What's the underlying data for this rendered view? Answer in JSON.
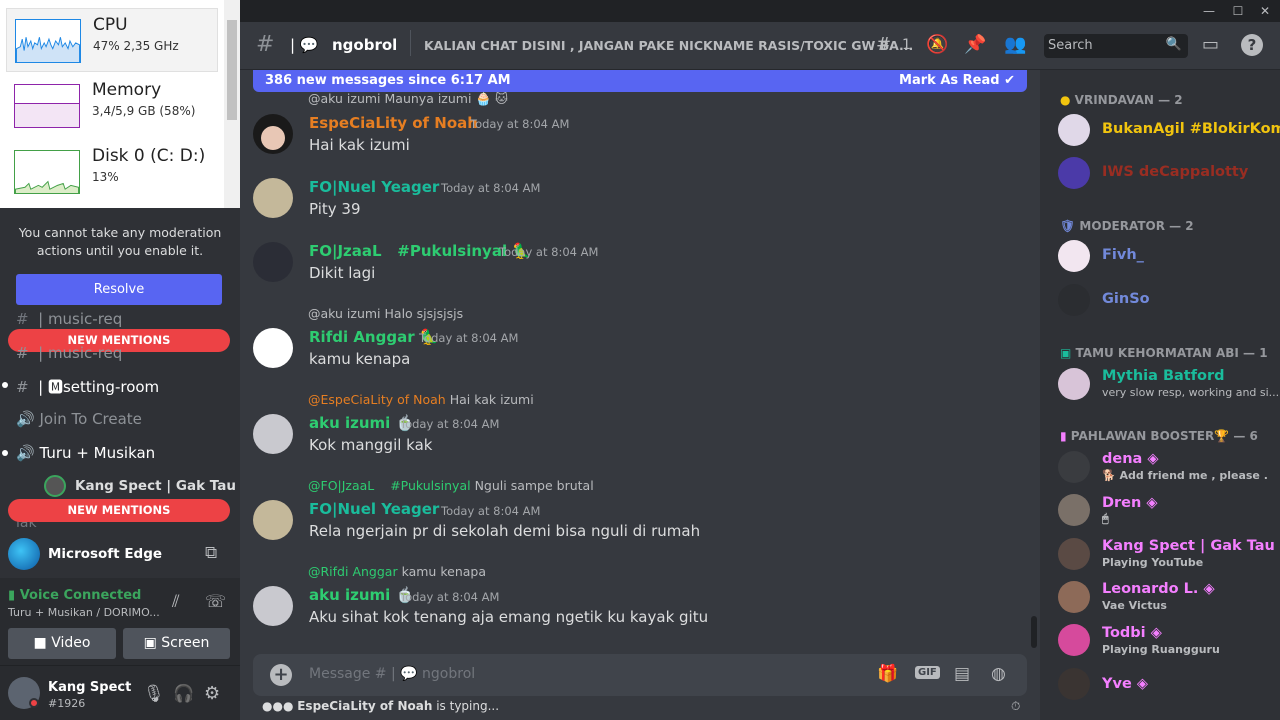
{
  "taskmgr": {
    "items": [
      {
        "name": "CPU",
        "value": "47% 2,35 GHz"
      },
      {
        "name": "Memory",
        "value": "3,4/5,9 GB (58%)"
      },
      {
        "name": "Disk 0 (C: D:)",
        "value": "13%"
      }
    ]
  },
  "moderation": {
    "message": "You cannot take any moderation actions until you enable it.",
    "resolve": "Resolve"
  },
  "sidebar": {
    "new_mentions": "NEW MENTIONS",
    "channels": [
      "music-req",
      "music-req",
      "| 🅼setting-room",
      "Join To Create",
      "Turu + Musikan",
      "Kang Spect | Gak Tau",
      "lak"
    ],
    "edge": "Microsoft Edge"
  },
  "voice": {
    "status": "Voice Connected",
    "channel": "Turu + Musikan / DORIMO...",
    "video": "Video",
    "screen": "Screen"
  },
  "user": {
    "name": "Kang Spect",
    "tag": "#1926"
  },
  "header": {
    "channel": "ngobrol",
    "prefix": "|",
    "topic": "KALIAN CHAT DISINI , JANGAN PAKE NICKNAME RASIS/TOXIC GW BA...",
    "threads": "1",
    "search": "Search"
  },
  "banner": {
    "text": "386 new messages since 6:17 AM",
    "mark": "Mark As Read"
  },
  "messages": [
    {
      "reply_user": "@aku izumi",
      "reply_text": "Maunya izumi",
      "user": "EspeCiaLity of Noah",
      "color": "#e67e22",
      "time": "Today at 8:04 AM",
      "text": "Hai kak izumi"
    },
    {
      "user": "FO|Nuel Yeager",
      "color": "#1abc9c",
      "time": "Today at 8:04 AM",
      "text": "Pity 39"
    },
    {
      "user": "FO|JzaaL",
      "user2": "#Pukulsinyal",
      "color": "#2ecc71",
      "time": "Today at 8:04 AM",
      "text": "Dikit lagi"
    },
    {
      "reply_user": "@aku izumi",
      "reply_text": "Halo sjsjsjsjs",
      "user": "Rifdi Anggar",
      "color": "#2ecc71",
      "time": "Today at 8:04 AM",
      "text": "kamu kenapa"
    },
    {
      "reply_user": "@EspeCiaLity of Noah",
      "reply_text": "Hai kak izumi",
      "user": "aku izumi",
      "color": "#2ecc71",
      "time": "Today at 8:04 AM",
      "text": "Kok manggil kak"
    },
    {
      "reply_user": "@FO|JzaaL",
      "reply_user2": "#Pukulsinyal",
      "reply_text": "Nguli sampe brutal",
      "user": "FO|Nuel Yeager",
      "color": "#1abc9c",
      "time": "Today at 8:04 AM",
      "text": "Rela ngerjain pr di sekolah demi bisa nguli di rumah"
    },
    {
      "reply_user": "@Rifdi Anggar",
      "reply_text": "kamu kenapa",
      "user": "aku izumi",
      "color": "#2ecc71",
      "time": "Today at 8:04 AM",
      "text": "Aku sihat kok tenang aja emang ngetik ku kayak gitu"
    }
  ],
  "composer": {
    "placeholder": "Message # | 💬 ngobrol",
    "typing": "EspeCiaLity of Noah",
    "typing_suffix": "is typing..."
  },
  "members": {
    "cat1": "VRINDAVAN — 2",
    "cat2": "MODERATOR — 2",
    "cat3": "TAMU KEHORMATAN ABI — 1",
    "cat4": "PAHLAWAN BOOSTER🏆 — 6",
    "list": [
      {
        "name": "BukanAgil #BlokirKom...",
        "color": "#f1c40f"
      },
      {
        "name": "IWS deCappalotty",
        "color": "#992d22"
      },
      {
        "name": "Fivh_",
        "color": "#7289da"
      },
      {
        "name": "GinSo",
        "color": "#7289da"
      },
      {
        "name": "Mythia Batford",
        "color": "#1abc9c",
        "status": "very slow resp, working and si..."
      },
      {
        "name": "dena",
        "color": "#f47fff",
        "status": "Add friend me , please ."
      },
      {
        "name": "Dren",
        "color": "#f47fff",
        "status": ""
      },
      {
        "name": "Kang Spect | Gak Tau",
        "color": "#f47fff",
        "status": "Playing YouTube"
      },
      {
        "name": "Leonardo L.",
        "color": "#f47fff",
        "status": "Vae Victus"
      },
      {
        "name": "Todbi",
        "color": "#f47fff",
        "status": "Playing Ruangguru"
      },
      {
        "name": "Yve",
        "color": "#f47fff"
      }
    ]
  }
}
